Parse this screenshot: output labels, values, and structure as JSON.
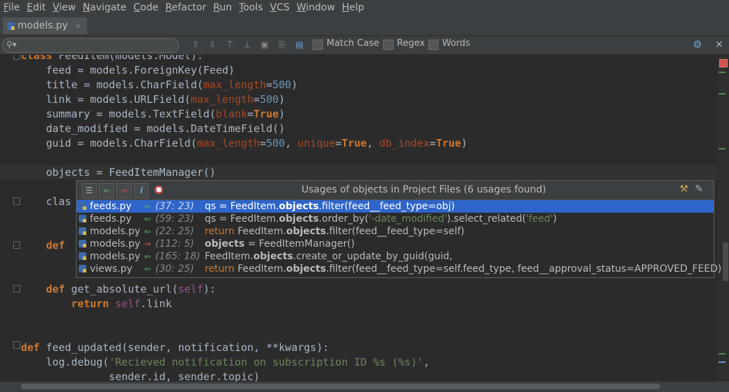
{
  "menu": [
    {
      "u": "F",
      "rest": "ile"
    },
    {
      "u": "E",
      "rest": "dit"
    },
    {
      "u": "V",
      "rest": "iew"
    },
    {
      "u": "N",
      "rest": "avigate"
    },
    {
      "u": "C",
      "rest": "ode"
    },
    {
      "u": "R",
      "rest": "efactor"
    },
    {
      "u": "R",
      "rest": "un"
    },
    {
      "u": "T",
      "rest": "ools"
    },
    {
      "u": "V",
      "rest": "CS"
    },
    {
      "u": "W",
      "rest": "indow"
    },
    {
      "u": "H",
      "rest": "elp"
    }
  ],
  "tab": {
    "label": "models.py",
    "close": "×"
  },
  "find": {
    "match_case": "Match Case",
    "regex": "Regex",
    "words": "Words",
    "close": "×"
  },
  "code_lines": [
    {
      "text": "class FeedItem(models.Model):"
    },
    {
      "text": "    feed = models.ForeignKey(Feed)"
    },
    {
      "text": "    title = models.CharField(max_length=500)"
    },
    {
      "text": "    link = models.URLField(max_length=500)"
    },
    {
      "text": "    summary = models.TextField(blank=True)"
    },
    {
      "text": "    date_modified = models.DateTimeField()"
    },
    {
      "text": "    guid = models.CharField(max_length=500, unique=True, db_index=True)"
    },
    {
      "text": ""
    },
    {
      "text": "    objects = FeedItemManager()"
    },
    {
      "text": ""
    },
    {
      "text": "    clas"
    },
    {
      "text": ""
    },
    {
      "text": ""
    },
    {
      "text": "    def"
    },
    {
      "text": ""
    },
    {
      "text": ""
    },
    {
      "text": "    def get_absolute_url(self):"
    },
    {
      "text": "        return self.link"
    },
    {
      "text": ""
    },
    {
      "text": ""
    },
    {
      "text": "def feed_updated(sender, notification, **kwargs):"
    },
    {
      "text": "    log.debug('Recieved notification on subscription ID %s (%s)',"
    },
    {
      "text": "              sender.id, sender.topic)"
    }
  ],
  "popup": {
    "title": "Usages of objects in Project Files (6 usages found)",
    "rows": [
      {
        "file": "feeds.py",
        "loc": "(37: 23)",
        "code": "qs = FeedItem.<b>objects</b>.filter(feed__feed_type=obj)",
        "selected": true,
        "write": false
      },
      {
        "file": "feeds.py",
        "loc": "(59: 23)",
        "code": "qs = FeedItem.<b>objects</b>.order_by(<span class=\"s\">'-date_modified'</span>).select_related(<span class=\"s\">'feed'</span>)",
        "selected": false,
        "write": false
      },
      {
        "file": "models.py",
        "loc": "(22: 25)",
        "code": "<span class=\"k\">return</span> FeedItem.<b>objects</b>.filter(feed__feed_type=self)",
        "selected": false,
        "write": false
      },
      {
        "file": "models.py",
        "loc": "(112: 5)",
        "code": "<b>objects</b> = FeedItemManager()",
        "selected": false,
        "write": true
      },
      {
        "file": "models.py",
        "loc": "(165: 18)",
        "code": "FeedItem.<b>objects</b>.create_or_update_by_guid(guid,",
        "selected": false,
        "write": false
      },
      {
        "file": "views.py",
        "loc": "(30: 25)",
        "code": "<span class=\"k\">return</span> FeedItem.<b>objects</b>.filter(feed__feed_type=self.feed_type, feed__approval_status=APPROVED_FEED)",
        "selected": false,
        "write": false
      }
    ]
  }
}
